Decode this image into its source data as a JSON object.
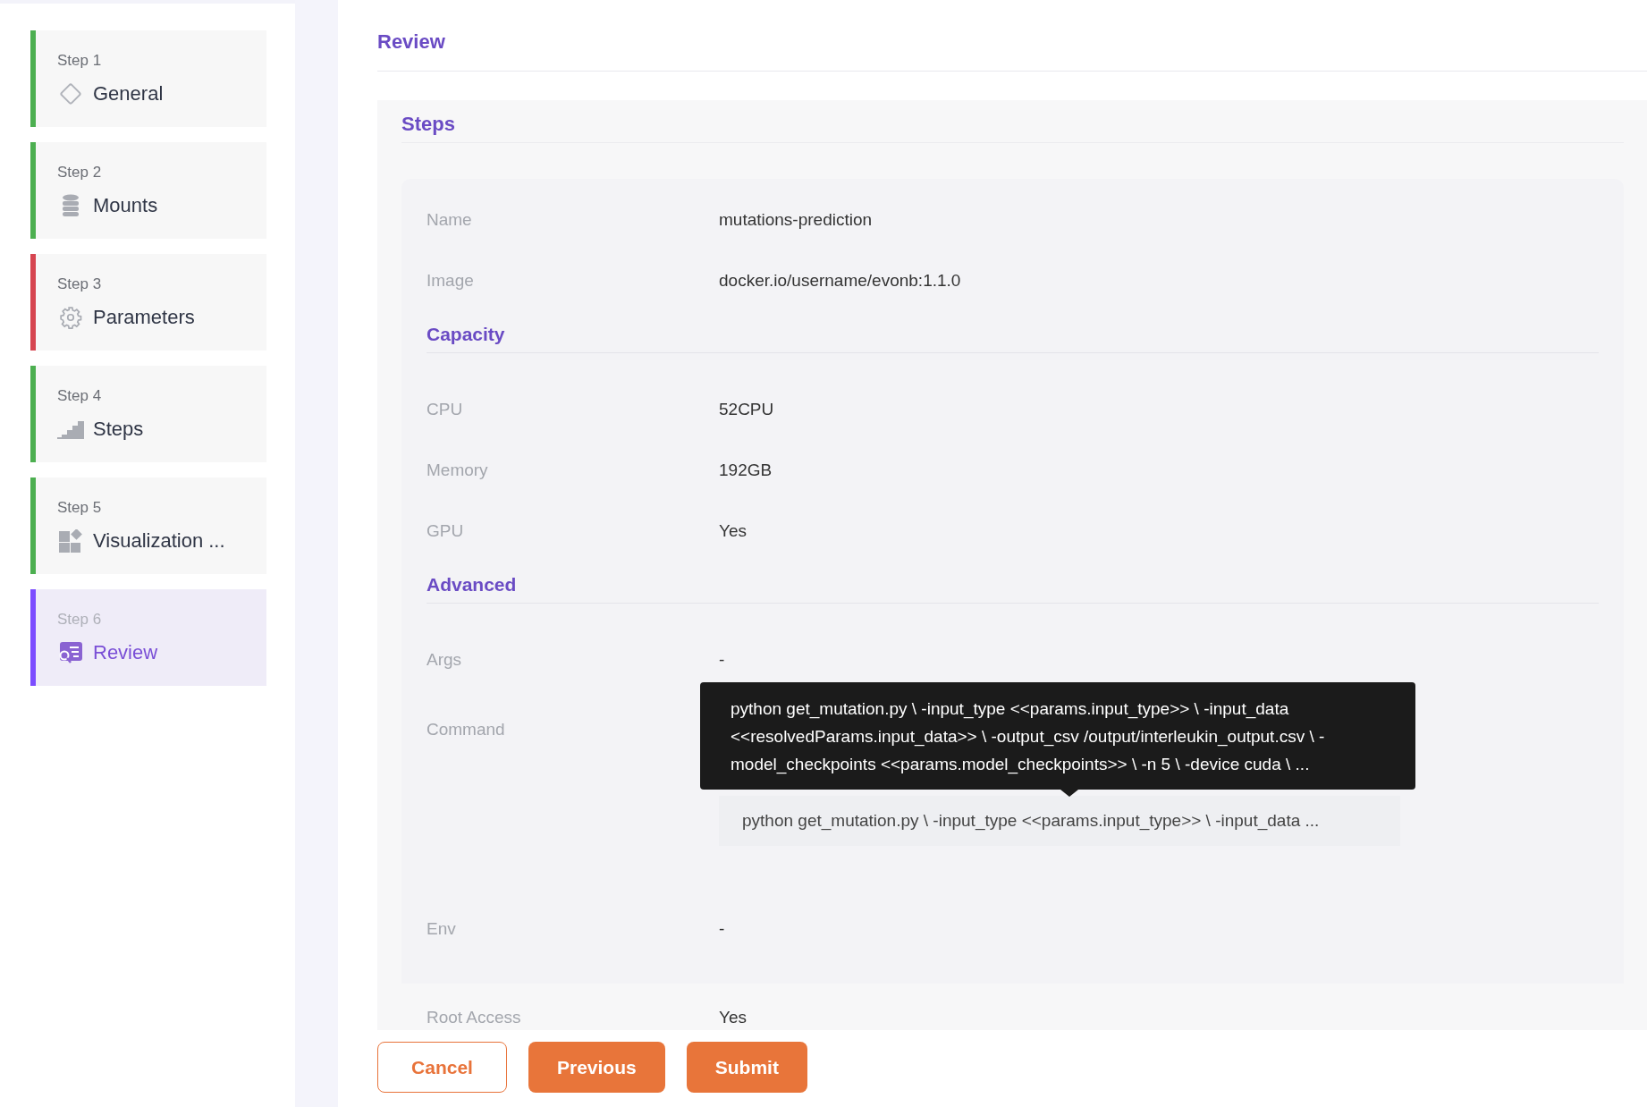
{
  "steps": [
    {
      "step": "Step 1",
      "label": "General",
      "color": "#4caf50",
      "selected": false
    },
    {
      "step": "Step 2",
      "label": "Mounts",
      "color": "#4caf50",
      "selected": false
    },
    {
      "step": "Step 3",
      "label": "Parameters",
      "color": "#d64550",
      "selected": false
    },
    {
      "step": "Step 4",
      "label": "Steps",
      "color": "#4caf50",
      "selected": false
    },
    {
      "step": "Step 5",
      "label": "Visualization ...",
      "color": "#4caf50",
      "selected": false
    },
    {
      "step": "Step 6",
      "label": "Review",
      "color": "#7c4dff",
      "selected": true
    }
  ],
  "page_title": "Review",
  "section_title": "Steps",
  "rows": [
    {
      "kind": "field",
      "label": "Name",
      "value": "mutations-prediction"
    },
    {
      "kind": "field",
      "label": "Image",
      "value": "docker.io/username/evonb:1.1.0"
    },
    {
      "kind": "heading",
      "label": "Capacity"
    },
    {
      "kind": "field",
      "label": "CPU",
      "value": "52CPU"
    },
    {
      "kind": "field",
      "label": "Memory",
      "value": "192GB"
    },
    {
      "kind": "field",
      "label": "GPU",
      "value": "Yes"
    },
    {
      "kind": "heading",
      "label": "Advanced"
    },
    {
      "kind": "field",
      "label": "Args",
      "value": "-"
    },
    {
      "kind": "command",
      "label": "Command",
      "value": "python get_mutation.py \\ -input_type <<params.input_type>> \\ -input_data ...",
      "tooltip": "python get_mutation.py \\ -input_type <<params.input_type>> \\ -input_data <<resolvedParams.input_data>> \\ -output_csv /output/interleukin_output.csv \\ -model_checkpoints <<params.model_checkpoints>> \\ -n 5 \\ -device cuda \\ ..."
    },
    {
      "kind": "tall",
      "label": "Env",
      "value": "-"
    },
    {
      "kind": "field",
      "label": "Root Access",
      "value": "Yes"
    }
  ],
  "buttons": [
    {
      "label": "Cancel",
      "kind": "outline"
    },
    {
      "label": "Previous",
      "kind": "solid"
    },
    {
      "label": "Submit",
      "kind": "solid"
    }
  ]
}
